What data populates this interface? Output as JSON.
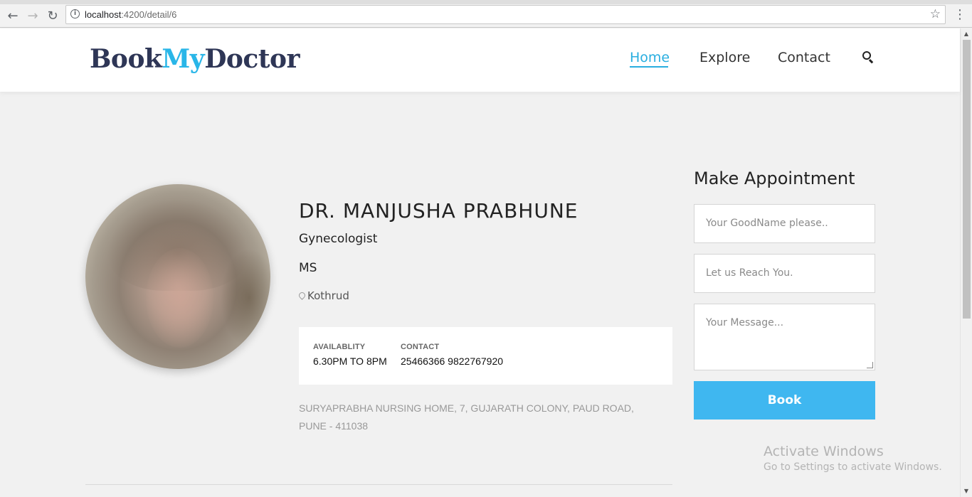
{
  "browser": {
    "url_host": "localhost",
    "url_rest": ":4200/detail/6",
    "icons": {
      "back": "arrow-left-icon",
      "forward": "arrow-right-icon",
      "reload": "reload-icon",
      "info": "info-icon",
      "bookmark": "star-icon",
      "menu": "kebab-menu-icon"
    }
  },
  "header": {
    "logo": {
      "part1": "Book",
      "part2": "My",
      "part3": "Doctor"
    },
    "nav": [
      {
        "label": "Home",
        "active": true
      },
      {
        "label": "Explore",
        "active": false
      },
      {
        "label": "Contact",
        "active": false
      }
    ],
    "search_icon": "search-icon"
  },
  "doctor": {
    "name": "DR. MANJUSHA PRABHUNE",
    "specialty": "Gynecologist",
    "degree": "MS",
    "location": "Kothrud",
    "availability_label": "AVAILABLITY",
    "availability_value": "6.30PM TO 8PM",
    "contact_label": "CONTACT",
    "contact_value": "25466366 9822767920",
    "address": "SURYAPRABHA NURSING HOME, 7, GUJARATH COLONY, PAUD ROAD, PUNE - 411038"
  },
  "appointment": {
    "title": "Make Appointment",
    "name_placeholder": "Your GoodName please..",
    "reach_placeholder": "Let us Reach You.",
    "message_placeholder": "Your Message...",
    "book_label": "Book"
  },
  "watermark": {
    "line1": "Activate Windows",
    "line2": "Go to Settings to activate Windows."
  },
  "colors": {
    "brand_dark": "#2e3656",
    "brand_accent": "#29b6e8",
    "button": "#3fb7f0",
    "page_bg": "#f1f1f1"
  }
}
